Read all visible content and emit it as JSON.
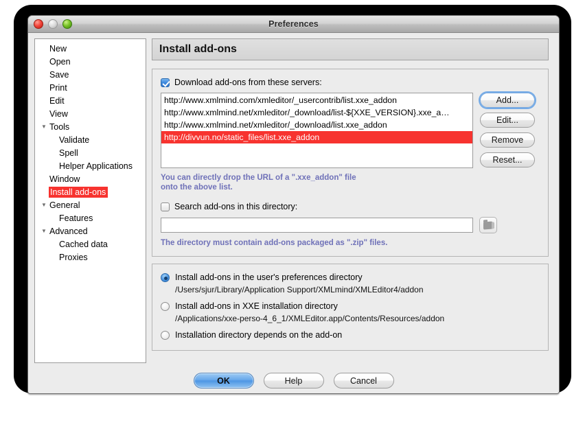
{
  "window": {
    "title": "Preferences",
    "controls": {
      "close": "close-button",
      "minimize": "minimize-button",
      "maximize": "maximize-button"
    }
  },
  "sidebar": {
    "items": [
      {
        "label": "New",
        "indent": 0,
        "twisty": "",
        "selected": false
      },
      {
        "label": "Open",
        "indent": 0,
        "twisty": "",
        "selected": false
      },
      {
        "label": "Save",
        "indent": 0,
        "twisty": "",
        "selected": false
      },
      {
        "label": "Print",
        "indent": 0,
        "twisty": "",
        "selected": false
      },
      {
        "label": "Edit",
        "indent": 0,
        "twisty": "",
        "selected": false
      },
      {
        "label": "View",
        "indent": 0,
        "twisty": "",
        "selected": false
      },
      {
        "label": "Tools",
        "indent": 0,
        "twisty": "▼",
        "selected": false
      },
      {
        "label": "Validate",
        "indent": 1,
        "twisty": "",
        "selected": false
      },
      {
        "label": "Spell",
        "indent": 1,
        "twisty": "",
        "selected": false
      },
      {
        "label": "Helper Applications",
        "indent": 1,
        "twisty": "",
        "selected": false
      },
      {
        "label": "Window",
        "indent": 0,
        "twisty": "",
        "selected": false
      },
      {
        "label": "Install add-ons",
        "indent": 0,
        "twisty": "",
        "selected": true
      },
      {
        "label": "General",
        "indent": 0,
        "twisty": "▼",
        "selected": false
      },
      {
        "label": "Features",
        "indent": 1,
        "twisty": "",
        "selected": false
      },
      {
        "label": "Advanced",
        "indent": 0,
        "twisty": "▼",
        "selected": false
      },
      {
        "label": "Cached data",
        "indent": 1,
        "twisty": "",
        "selected": false
      },
      {
        "label": "Proxies",
        "indent": 1,
        "twisty": "",
        "selected": false
      }
    ]
  },
  "page": {
    "header": "Install add-ons"
  },
  "servers": {
    "checkbox_label": "Download add-ons from these servers:",
    "checked": true,
    "list": [
      {
        "url": "http://www.xmlmind.com/xmleditor/_usercontrib/list.xxe_addon",
        "selected": false
      },
      {
        "url": "http://www.xmlmind.net/xmleditor/_download/list-${XXE_VERSION}.xxe_a…",
        "selected": false
      },
      {
        "url": "http://www.xmlmind.net/xmleditor/_download/list.xxe_addon",
        "selected": false
      },
      {
        "url": "http://divvun.no/static_files/list.xxe_addon",
        "selected": true
      }
    ],
    "buttons": [
      {
        "label": "Add...",
        "focused": true
      },
      {
        "label": "Edit...",
        "focused": false
      },
      {
        "label": "Remove",
        "focused": false
      },
      {
        "label": "Reset...",
        "focused": false
      }
    ],
    "hint_line1": "You can directly drop the URL of a \".xxe_addon\" file",
    "hint_line2": "onto the above list."
  },
  "directory": {
    "checkbox_label": "Search add-ons in this directory:",
    "checked": false,
    "value": "",
    "browse_icon": "folder-icon",
    "hint": "The directory must contain add-ons packaged as \".zip\" files."
  },
  "install_location": {
    "options": [
      {
        "label": "Install add-ons in the user's preferences directory",
        "path": "/Users/sjur/Library/Application Support/XMLmind/XMLEditor4/addon",
        "selected": true
      },
      {
        "label": "Install add-ons in XXE installation directory",
        "path": "/Applications/xxe-perso-4_6_1/XMLEditor.app/Contents/Resources/addon",
        "selected": false
      },
      {
        "label": "Installation directory depends on the add-on",
        "path": "",
        "selected": false
      }
    ]
  },
  "footer": {
    "ok": "OK",
    "help": "Help",
    "cancel": "Cancel"
  },
  "colors": {
    "selection_red": "#f7332f",
    "hint_purple": "#6f71b8",
    "accent_blue": "#4e96e4"
  }
}
